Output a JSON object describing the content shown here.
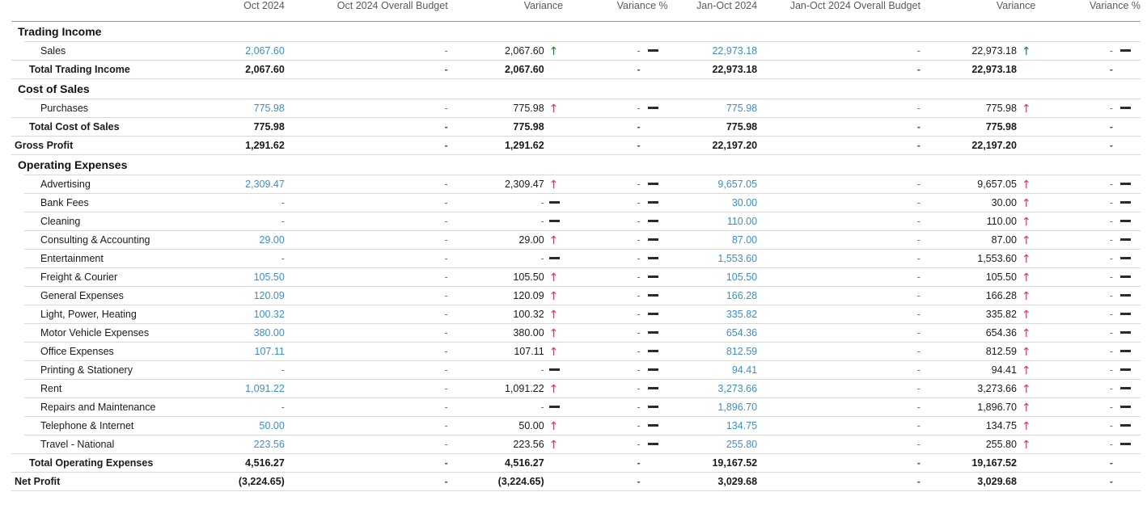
{
  "report": {
    "columns": [
      {
        "key": "label",
        "label": ""
      },
      {
        "key": "act1",
        "label": "Oct 2024"
      },
      {
        "key": "bud1",
        "label": "Oct 2024 Overall Budget"
      },
      {
        "key": "var1",
        "label": "Variance"
      },
      {
        "key": "pct1",
        "label": "Variance %"
      },
      {
        "key": "act2",
        "label": "Jan-Oct 2024"
      },
      {
        "key": "bud2",
        "label": "Jan-Oct 2024 Overall Budget"
      },
      {
        "key": "var2",
        "label": "Variance"
      },
      {
        "key": "pct2",
        "label": "Variance %"
      }
    ],
    "colors": {
      "link_blue": "#3d8ec9",
      "arrow_up_favorable": "#1a7d3c",
      "arrow_up_unfavorable": "#cf3b52",
      "header_text": "#5a5a5a",
      "rule": "#d8d8d8"
    },
    "rows": [
      {
        "type": "section",
        "label": "Trading Income"
      },
      {
        "type": "item",
        "label": "Sales",
        "act1": "2,067.60",
        "bud1": "-",
        "var1": "2,067.60",
        "ind1": "up-good",
        "pct1": "-",
        "pind1": "flat",
        "act2": "22,973.18",
        "bud2": "-",
        "var2": "22,973.18",
        "ind2": "up-good",
        "pct2": "-",
        "pind2": "flat"
      },
      {
        "type": "total",
        "label": "Total Trading Income",
        "act1": "2,067.60",
        "bud1": "-",
        "var1": "2,067.60",
        "ind1": "",
        "pct1": "-",
        "pind1": "",
        "act2": "22,973.18",
        "bud2": "-",
        "var2": "22,973.18",
        "ind2": "",
        "pct2": "-",
        "pind2": ""
      },
      {
        "type": "section",
        "label": "Cost of Sales"
      },
      {
        "type": "item",
        "label": "Purchases",
        "act1": "775.98",
        "bud1": "-",
        "var1": "775.98",
        "ind1": "up-bad",
        "pct1": "-",
        "pind1": "flat",
        "act2": "775.98",
        "bud2": "-",
        "var2": "775.98",
        "ind2": "up-bad",
        "pct2": "-",
        "pind2": "flat"
      },
      {
        "type": "total",
        "label": "Total Cost of Sales",
        "act1": "775.98",
        "bud1": "-",
        "var1": "775.98",
        "ind1": "",
        "pct1": "-",
        "pind1": "",
        "act2": "775.98",
        "bud2": "-",
        "var2": "775.98",
        "ind2": "",
        "pct2": "-",
        "pind2": ""
      },
      {
        "type": "grand",
        "label": "Gross Profit",
        "act1": "1,291.62",
        "bud1": "-",
        "var1": "1,291.62",
        "ind1": "",
        "pct1": "-",
        "pind1": "",
        "act2": "22,197.20",
        "bud2": "-",
        "var2": "22,197.20",
        "ind2": "",
        "pct2": "-",
        "pind2": ""
      },
      {
        "type": "section",
        "label": "Operating Expenses"
      },
      {
        "type": "item",
        "label": "Advertising",
        "act1": "2,309.47",
        "bud1": "-",
        "var1": "2,309.47",
        "ind1": "up-bad",
        "pct1": "-",
        "pind1": "flat",
        "act2": "9,657.05",
        "bud2": "-",
        "var2": "9,657.05",
        "ind2": "up-bad",
        "pct2": "-",
        "pind2": "flat"
      },
      {
        "type": "item",
        "label": "Bank Fees",
        "act1": "-",
        "bud1": "-",
        "var1": "-",
        "ind1": "flat",
        "pct1": "-",
        "pind1": "flat",
        "act2": "30.00",
        "bud2": "-",
        "var2": "30.00",
        "ind2": "up-bad",
        "pct2": "-",
        "pind2": "flat"
      },
      {
        "type": "item",
        "label": "Cleaning",
        "act1": "-",
        "bud1": "-",
        "var1": "-",
        "ind1": "flat",
        "pct1": "-",
        "pind1": "flat",
        "act2": "110.00",
        "bud2": "-",
        "var2": "110.00",
        "ind2": "up-bad",
        "pct2": "-",
        "pind2": "flat"
      },
      {
        "type": "item",
        "label": "Consulting & Accounting",
        "act1": "29.00",
        "bud1": "-",
        "var1": "29.00",
        "ind1": "up-bad",
        "pct1": "-",
        "pind1": "flat",
        "act2": "87.00",
        "bud2": "-",
        "var2": "87.00",
        "ind2": "up-bad",
        "pct2": "-",
        "pind2": "flat"
      },
      {
        "type": "item",
        "label": "Entertainment",
        "act1": "-",
        "bud1": "-",
        "var1": "-",
        "ind1": "flat",
        "pct1": "-",
        "pind1": "flat",
        "act2": "1,553.60",
        "bud2": "-",
        "var2": "1,553.60",
        "ind2": "up-bad",
        "pct2": "-",
        "pind2": "flat"
      },
      {
        "type": "item",
        "label": "Freight & Courier",
        "act1": "105.50",
        "bud1": "-",
        "var1": "105.50",
        "ind1": "up-bad",
        "pct1": "-",
        "pind1": "flat",
        "act2": "105.50",
        "bud2": "-",
        "var2": "105.50",
        "ind2": "up-bad",
        "pct2": "-",
        "pind2": "flat"
      },
      {
        "type": "item",
        "label": "General Expenses",
        "act1": "120.09",
        "bud1": "-",
        "var1": "120.09",
        "ind1": "up-bad",
        "pct1": "-",
        "pind1": "flat",
        "act2": "166.28",
        "bud2": "-",
        "var2": "166.28",
        "ind2": "up-bad",
        "pct2": "-",
        "pind2": "flat"
      },
      {
        "type": "item",
        "label": "Light, Power, Heating",
        "act1": "100.32",
        "bud1": "-",
        "var1": "100.32",
        "ind1": "up-bad",
        "pct1": "-",
        "pind1": "flat",
        "act2": "335.82",
        "bud2": "-",
        "var2": "335.82",
        "ind2": "up-bad",
        "pct2": "-",
        "pind2": "flat"
      },
      {
        "type": "item",
        "label": "Motor Vehicle Expenses",
        "act1": "380.00",
        "bud1": "-",
        "var1": "380.00",
        "ind1": "up-bad",
        "pct1": "-",
        "pind1": "flat",
        "act2": "654.36",
        "bud2": "-",
        "var2": "654.36",
        "ind2": "up-bad",
        "pct2": "-",
        "pind2": "flat"
      },
      {
        "type": "item",
        "label": "Office Expenses",
        "act1": "107.11",
        "bud1": "-",
        "var1": "107.11",
        "ind1": "up-bad",
        "pct1": "-",
        "pind1": "flat",
        "act2": "812.59",
        "bud2": "-",
        "var2": "812.59",
        "ind2": "up-bad",
        "pct2": "-",
        "pind2": "flat"
      },
      {
        "type": "item",
        "label": "Printing & Stationery",
        "act1": "-",
        "bud1": "-",
        "var1": "-",
        "ind1": "flat",
        "pct1": "-",
        "pind1": "flat",
        "act2": "94.41",
        "bud2": "-",
        "var2": "94.41",
        "ind2": "up-bad",
        "pct2": "-",
        "pind2": "flat"
      },
      {
        "type": "item",
        "label": "Rent",
        "act1": "1,091.22",
        "bud1": "-",
        "var1": "1,091.22",
        "ind1": "up-bad",
        "pct1": "-",
        "pind1": "flat",
        "act2": "3,273.66",
        "bud2": "-",
        "var2": "3,273.66",
        "ind2": "up-bad",
        "pct2": "-",
        "pind2": "flat"
      },
      {
        "type": "item",
        "label": "Repairs and Maintenance",
        "act1": "-",
        "bud1": "-",
        "var1": "-",
        "ind1": "flat",
        "pct1": "-",
        "pind1": "flat",
        "act2": "1,896.70",
        "bud2": "-",
        "var2": "1,896.70",
        "ind2": "up-bad",
        "pct2": "-",
        "pind2": "flat"
      },
      {
        "type": "item",
        "label": "Telephone & Internet",
        "act1": "50.00",
        "bud1": "-",
        "var1": "50.00",
        "ind1": "up-bad",
        "pct1": "-",
        "pind1": "flat",
        "act2": "134.75",
        "bud2": "-",
        "var2": "134.75",
        "ind2": "up-bad",
        "pct2": "-",
        "pind2": "flat"
      },
      {
        "type": "item",
        "label": "Travel - National",
        "act1": "223.56",
        "bud1": "-",
        "var1": "223.56",
        "ind1": "up-bad",
        "pct1": "-",
        "pind1": "flat",
        "act2": "255.80",
        "bud2": "-",
        "var2": "255.80",
        "ind2": "up-bad",
        "pct2": "-",
        "pind2": "flat"
      },
      {
        "type": "total",
        "label": "Total Operating Expenses",
        "act1": "4,516.27",
        "bud1": "-",
        "var1": "4,516.27",
        "ind1": "",
        "pct1": "-",
        "pind1": "",
        "act2": "19,167.52",
        "bud2": "-",
        "var2": "19,167.52",
        "ind2": "",
        "pct2": "-",
        "pind2": ""
      },
      {
        "type": "grand",
        "label": "Net Profit",
        "act1": "(3,224.65)",
        "bud1": "-",
        "var1": "(3,224.65)",
        "ind1": "",
        "pct1": "-",
        "pind1": "",
        "act2": "3,029.68",
        "bud2": "-",
        "var2": "3,029.68",
        "ind2": "",
        "pct2": "-",
        "pind2": ""
      }
    ]
  }
}
